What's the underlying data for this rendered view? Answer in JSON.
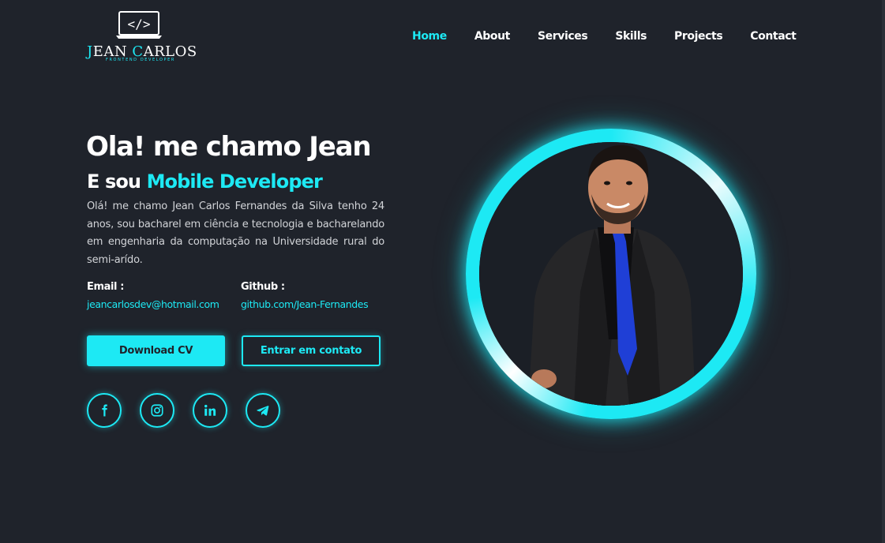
{
  "logo": {
    "brand_first": "J",
    "brand_rest": "EAN ",
    "brand_c": "C",
    "brand_rest2": "ARLOS",
    "code_symbol": "</>",
    "tagline": "FRONTEND DEVELOPER",
    "icon": "laptop-code-icon"
  },
  "nav": {
    "items": [
      {
        "label": "Home",
        "active": true
      },
      {
        "label": "About",
        "active": false
      },
      {
        "label": "Services",
        "active": false
      },
      {
        "label": "Skills",
        "active": false
      },
      {
        "label": "Projects",
        "active": false
      },
      {
        "label": "Contact",
        "active": false
      }
    ]
  },
  "hero": {
    "title": "Ola! me chamo Jean",
    "subtitle_prefix": "E sou ",
    "subtitle_highlight": "Mobile Developer",
    "bio": "Olá! me chamo Jean Carlos Fernandes da Silva tenho 24 anos, sou bacharel em ciência e tecnologia e bacharelando em engenharia da computação na Universidade rural do semi-arído."
  },
  "contact": {
    "email_label": "Email :",
    "email_value": "jeancarlosdev@hotmail.com",
    "github_label": "Github :",
    "github_value": "github.com/Jean-Fernandes"
  },
  "buttons": {
    "download": "Download CV",
    "contact": "Entrar em contato"
  },
  "social": [
    "facebook-icon",
    "instagram-icon",
    "linkedin-icon",
    "telegram-icon"
  ],
  "colors": {
    "accent": "#1de9f4",
    "background": "#1f232b",
    "text": "#ffffff",
    "tie": "#1f3fd6"
  }
}
